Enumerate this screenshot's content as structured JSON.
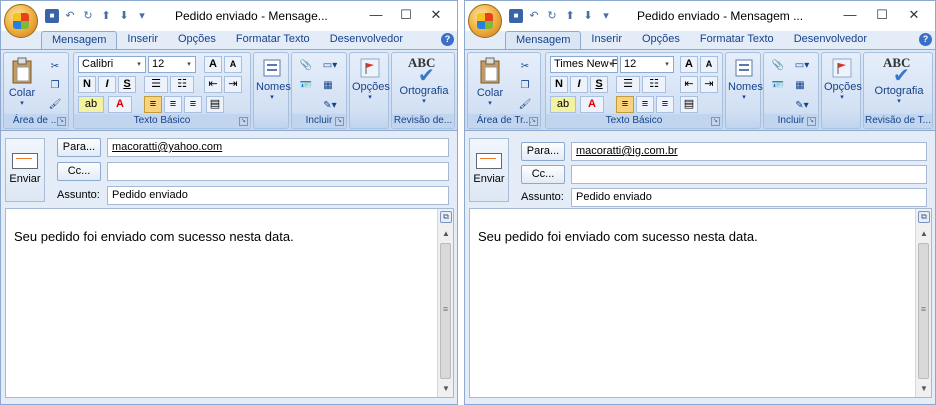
{
  "windows": [
    {
      "title": "Pedido enviado - Mensage...",
      "tabs": [
        "Mensagem",
        "Inserir",
        "Opções",
        "Formatar Texto",
        "Desenvolvedor"
      ],
      "groups": {
        "area": "Área de ...",
        "texto": "Texto Básico",
        "incluir": "Incluir",
        "revisao": "Revisão de..."
      },
      "buttons": {
        "colar": "Colar",
        "nomes": "Nomes",
        "opcoes": "Opções",
        "ortografia": "Ortografia",
        "enviar": "Enviar"
      },
      "font_name": "Calibri",
      "font_size": "12",
      "fields": {
        "para_label": "Para...",
        "cc_label": "Cc...",
        "assunto_label": "Assunto:",
        "para_value": "macoratti@yahoo.com",
        "cc_value": "",
        "assunto_value": "Pedido enviado"
      },
      "body_text": "Seu pedido foi enviado com sucesso nesta data."
    },
    {
      "title": "Pedido enviado - Mensagem ...",
      "tabs": [
        "Mensagem",
        "Inserir",
        "Opções",
        "Formatar Texto",
        "Desenvolvedor"
      ],
      "groups": {
        "area": "Área de Tr...",
        "texto": "Texto Básico",
        "incluir": "Incluir",
        "revisao": "Revisão de T..."
      },
      "buttons": {
        "colar": "Colar",
        "nomes": "Nomes",
        "opcoes": "Opções",
        "ortografia": "Ortografia",
        "enviar": "Enviar"
      },
      "font_name": "Times New F",
      "font_size": "12",
      "fields": {
        "para_label": "Para...",
        "cc_label": "Cc...",
        "assunto_label": "Assunto:",
        "para_value": "macoratti@ig.com.br",
        "cc_value": "",
        "assunto_value": "Pedido enviado"
      },
      "body_text": "Seu pedido foi enviado com sucesso nesta data."
    }
  ],
  "icons": {
    "close": "✕",
    "maximize": "☐",
    "minimize": "—",
    "help": "?",
    "dropdown": "▾",
    "arrow_up": "▲",
    "arrow_down": "▼",
    "abc": "ABC"
  },
  "format_labels": {
    "bold": "N",
    "italic": "I",
    "underline": "S",
    "grow": "A",
    "shrink": "A",
    "color_a": "A"
  },
  "colors": {
    "accent": "#15428b",
    "ribbon": "#c6d8ef",
    "highlight": "#f8d27c"
  }
}
